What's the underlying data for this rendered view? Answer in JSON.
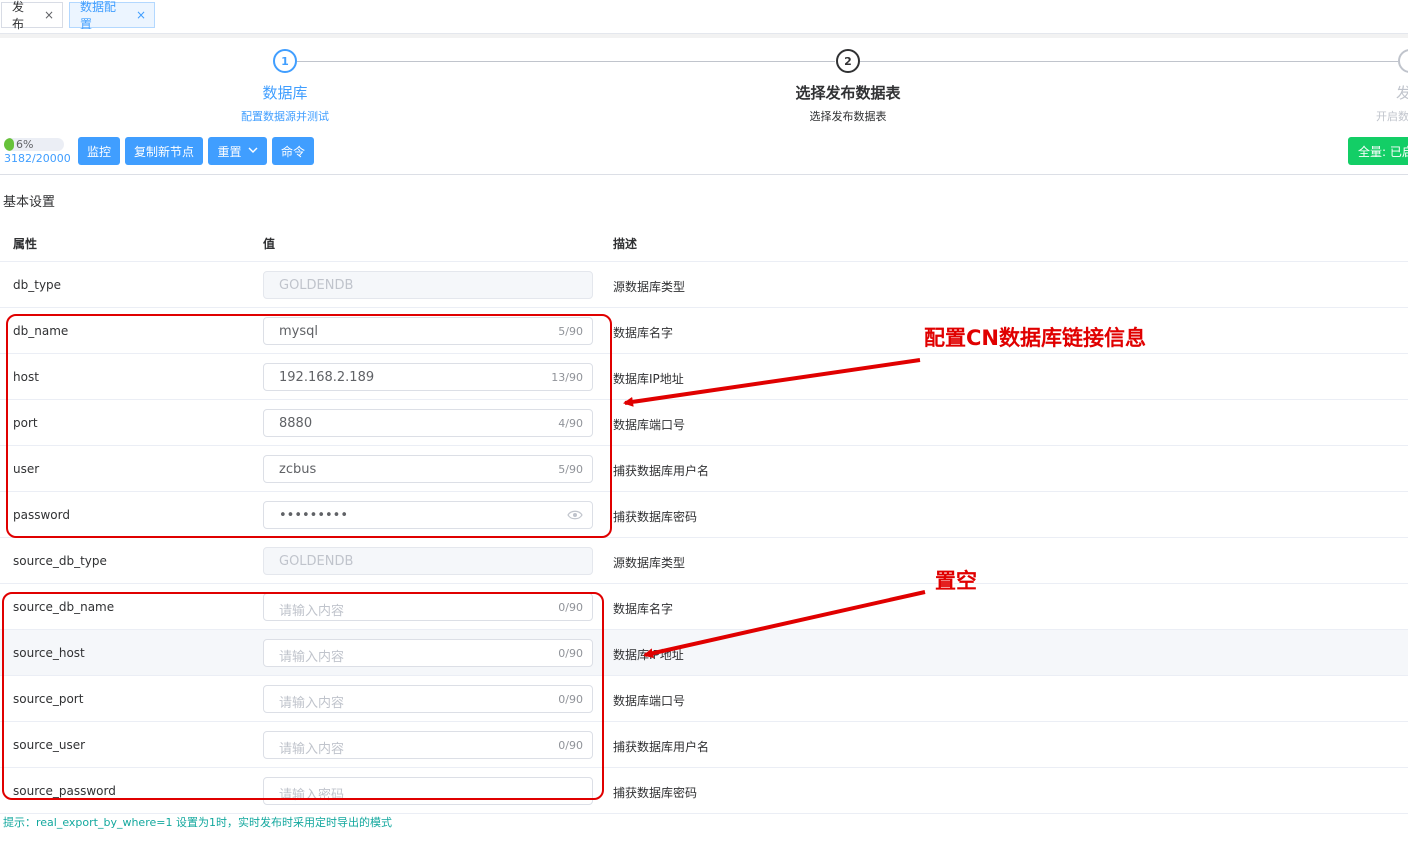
{
  "tabs": [
    {
      "label": "发布",
      "active": false
    },
    {
      "label": "数据配置",
      "active": true
    }
  ],
  "steps": [
    {
      "num": "1",
      "title": "数据库",
      "desc": "配置数据源并测试"
    },
    {
      "num": "2",
      "title": "选择发布数据表",
      "desc": "选择发布数据表"
    },
    {
      "num": "3",
      "title": "发",
      "desc": "开启数"
    }
  ],
  "toolbar": {
    "progress_label": "6%",
    "progress_fraction": 0.16,
    "progress_count": "3182/20000",
    "buttons": [
      "监控",
      "复制新节点",
      "重置",
      "命令"
    ],
    "right_button": "全量: 已启"
  },
  "section_title": "基本设置",
  "table": {
    "headers": {
      "attr": "属性",
      "value": "值",
      "desc": "描述"
    },
    "rows": [
      {
        "attr": "db_type",
        "value": "GOLDENDB",
        "placeholder": "",
        "count": "",
        "desc": "源数据库类型",
        "disabled": true
      },
      {
        "attr": "db_name",
        "value": "mysql",
        "placeholder": "",
        "count": "5/90",
        "desc": "数据库名字",
        "disabled": false
      },
      {
        "attr": "host",
        "value": "192.168.2.189",
        "placeholder": "",
        "count": "13/90",
        "desc": "数据库IP地址",
        "disabled": false
      },
      {
        "attr": "port",
        "value": "8880",
        "placeholder": "",
        "count": "4/90",
        "desc": "数据库端口号",
        "disabled": false
      },
      {
        "attr": "user",
        "value": "zcbus",
        "placeholder": "",
        "count": "5/90",
        "desc": "捕获数据库用户名",
        "disabled": false
      },
      {
        "attr": "password",
        "value": "•••••••••",
        "placeholder": "",
        "count": "",
        "desc": "捕获数据库密码",
        "disabled": false,
        "password": true
      },
      {
        "attr": "source_db_type",
        "value": "GOLDENDB",
        "placeholder": "",
        "count": "",
        "desc": "源数据库类型",
        "disabled": true
      },
      {
        "attr": "source_db_name",
        "value": "",
        "placeholder": "请输入内容",
        "count": "0/90",
        "desc": "数据库名字",
        "disabled": false
      },
      {
        "attr": "source_host",
        "value": "",
        "placeholder": "请输入内容",
        "count": "0/90",
        "desc": "数据库IP地址",
        "disabled": false
      },
      {
        "attr": "source_port",
        "value": "",
        "placeholder": "请输入内容",
        "count": "0/90",
        "desc": "数据库端口号",
        "disabled": false
      },
      {
        "attr": "source_user",
        "value": "",
        "placeholder": "请输入内容",
        "count": "0/90",
        "desc": "捕获数据库用户名",
        "disabled": false
      },
      {
        "attr": "source_password",
        "value": "",
        "placeholder": "请输入密码",
        "count": "",
        "desc": "捕获数据库密码",
        "disabled": false
      }
    ]
  },
  "tip": "提示：real_export_by_where=1 设置为1时，实时发布时采用定时导出的模式",
  "annotations": {
    "top_text": "配置CN数据库链接信息",
    "bottom_text": "置空"
  },
  "colors": {
    "primary": "#409eff",
    "success": "#13ce66",
    "annotation_red": "#e00000",
    "tip": "#13a89e"
  }
}
